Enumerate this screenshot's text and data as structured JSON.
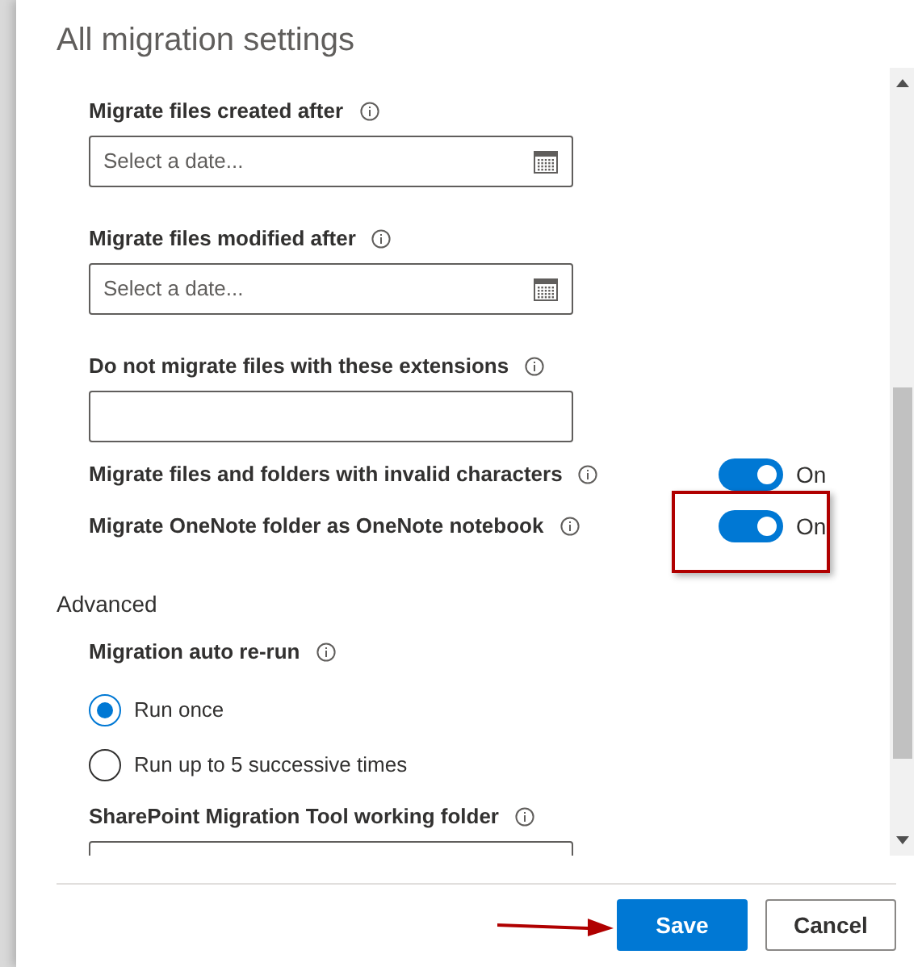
{
  "dialog": {
    "title": "All migration settings"
  },
  "fields": [
    {
      "label": "Migrate files created after",
      "placeholder": "Select a date...",
      "kind": "date"
    },
    {
      "label": "Migrate files modified after",
      "placeholder": "Select a date...",
      "kind": "date"
    },
    {
      "label": "Do not migrate files with these extensions",
      "kind": "text"
    }
  ],
  "toggles": [
    {
      "label": "Migrate files and folders with invalid characters",
      "on": true,
      "state_text": "On",
      "highlighted": false
    },
    {
      "label": "Migrate OneNote folder as OneNote notebook",
      "on": true,
      "state_text": "On",
      "highlighted": true
    }
  ],
  "advanced": {
    "heading": "Advanced",
    "rerun_label": "Migration auto re-run",
    "options": [
      {
        "label": "Run once",
        "selected": true
      },
      {
        "label": "Run up to 5 successive times",
        "selected": false
      }
    ],
    "folder_label": "SharePoint Migration Tool working folder"
  },
  "buttons": [
    {
      "label": "Save",
      "kind": "primary",
      "pointed": true
    },
    {
      "label": "Cancel",
      "kind": "secondary",
      "pointed": false
    }
  ]
}
